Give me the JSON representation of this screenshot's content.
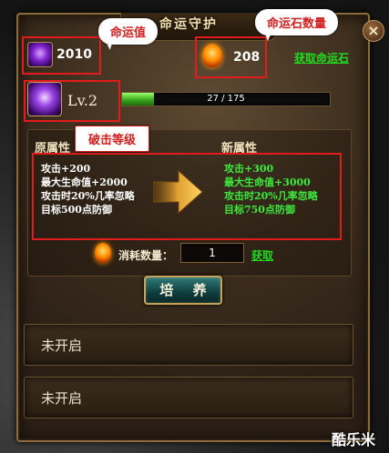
{
  "window": {
    "title": "命运守护",
    "close_icon": "close-icon"
  },
  "callouts": {
    "luck_value": "命运值",
    "stone_count": "命运石数量",
    "break_level": "破击等级"
  },
  "resources": {
    "luck_value": "2010",
    "stone_count": "208",
    "get_stone_link": "获取命运石"
  },
  "level": {
    "label": "Lv.2",
    "progress_text": "27 / 175",
    "progress_current": 27,
    "progress_max": 175
  },
  "attributes": {
    "old_title": "原属性",
    "new_title": "新属性",
    "old": [
      "攻击+200",
      "最大生命值+2000",
      "攻击时20%几率忽略",
      "目标500点防御"
    ],
    "new": [
      "攻击+300",
      "最大生命值+3000",
      "攻击时20%几率忽略",
      "目标750点防御"
    ]
  },
  "cost": {
    "label": "消耗数量：",
    "value": "1",
    "get_link": "获取"
  },
  "actions": {
    "cultivate_label": "培 养"
  },
  "slots": [
    {
      "label": "未开启"
    },
    {
      "label": "未开启"
    }
  ],
  "watermark": "酷乐米",
  "colors": {
    "accent_green": "#3cea3c",
    "callout_red": "#d02020",
    "panel_brown": "#35281b",
    "gold_border": "#8a6d3a"
  }
}
